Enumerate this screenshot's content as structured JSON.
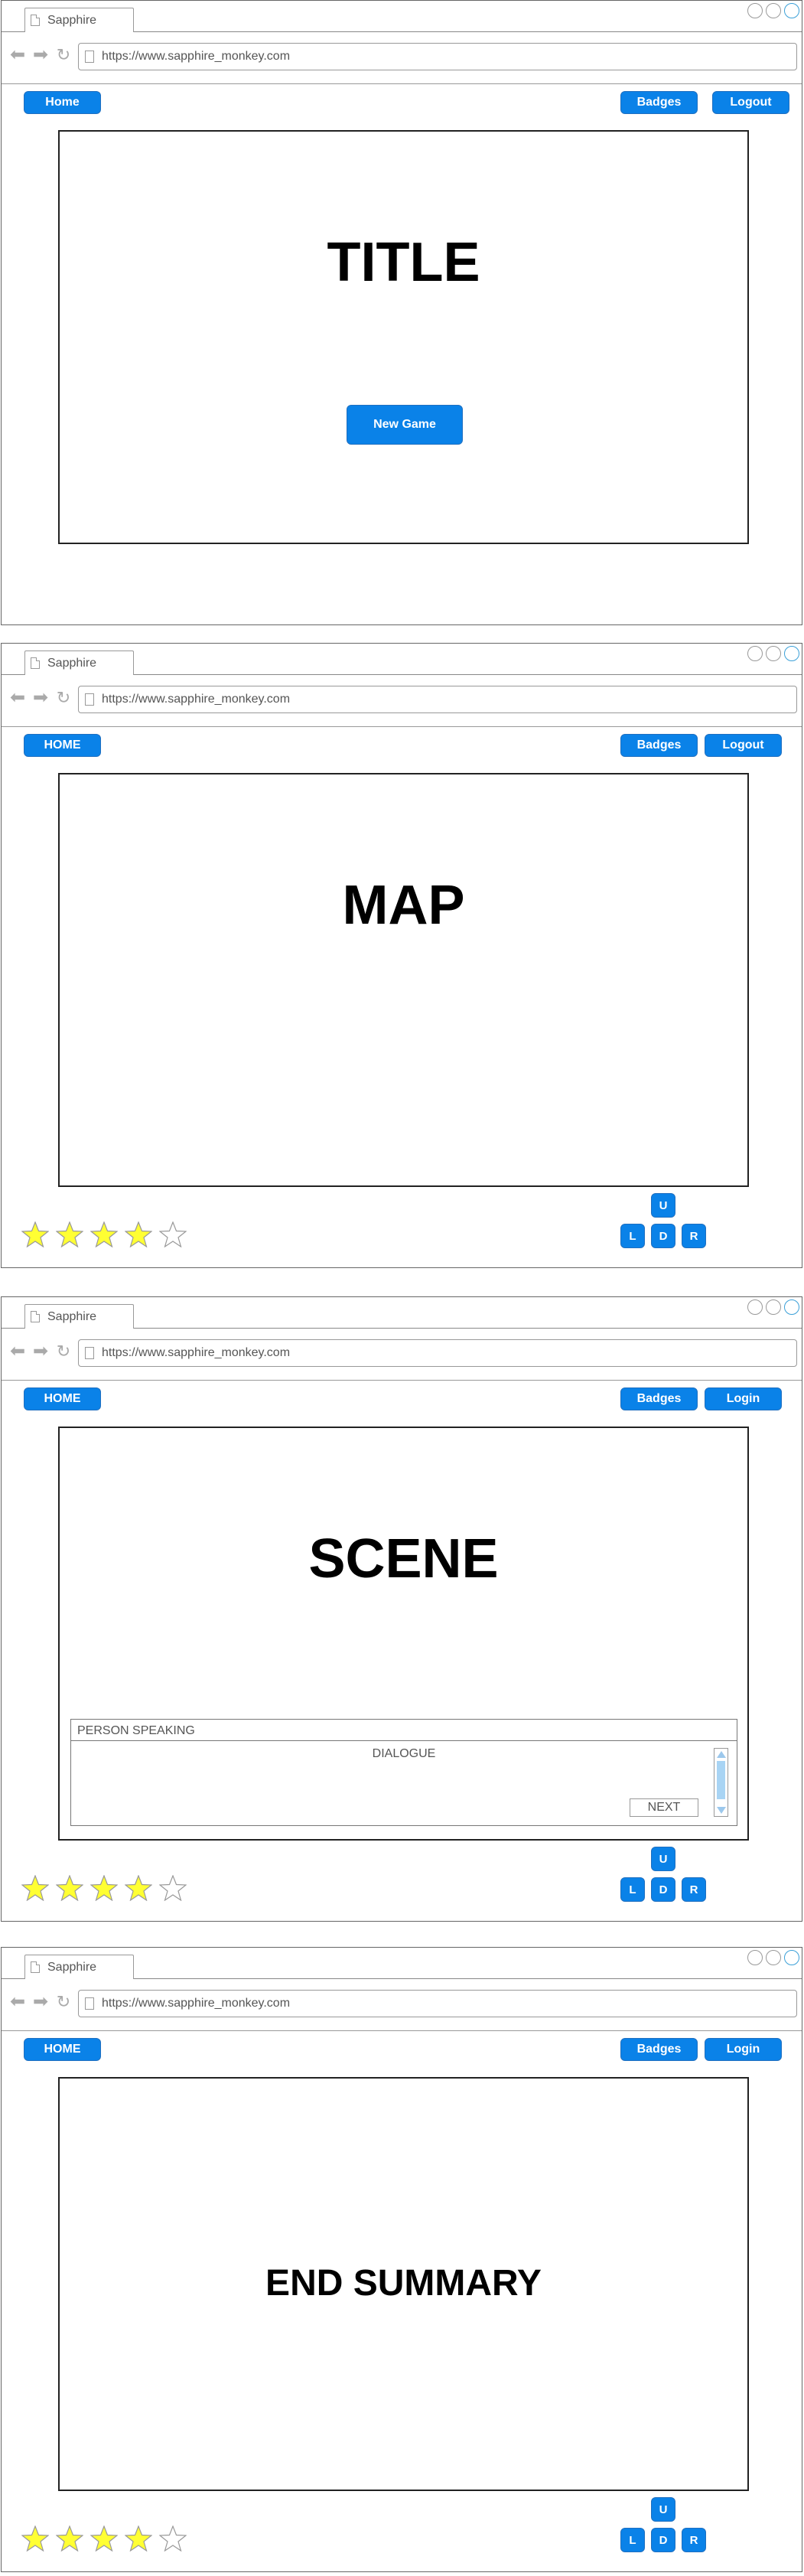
{
  "browser": {
    "tab_label": "Sapphire",
    "url": "https://www.sapphire_monkey.com"
  },
  "frames": [
    {
      "home_label": "Home",
      "badges_label": "Badges",
      "auth_label": "Logout",
      "title": "TITLE",
      "new_game_label": "New Game"
    },
    {
      "home_label": "HOME",
      "badges_label": "Badges",
      "auth_label": "Logout",
      "title": "MAP",
      "stars": {
        "filled": 4,
        "total": 5
      },
      "dpad": {
        "up": "U",
        "left": "L",
        "down": "D",
        "right": "R"
      }
    },
    {
      "home_label": "HOME",
      "badges_label": "Badges",
      "auth_label": "Login",
      "title": "SCENE",
      "dialogue": {
        "speaker": "PERSON SPEAKING",
        "text": "DIALOGUE",
        "next_label": "NEXT"
      },
      "stars": {
        "filled": 4,
        "total": 5
      },
      "dpad": {
        "up": "U",
        "left": "L",
        "down": "D",
        "right": "R"
      }
    },
    {
      "home_label": "HOME",
      "badges_label": "Badges",
      "auth_label": "Login",
      "title": "END SUMMARY",
      "stars": {
        "filled": 4,
        "total": 5
      },
      "dpad": {
        "up": "U",
        "left": "L",
        "down": "D",
        "right": "R"
      }
    }
  ],
  "colors": {
    "button_blue": "#0a82e8",
    "star_fill": "#ffff33"
  },
  "icons": [
    "page-icon",
    "back-arrow-icon",
    "forward-arrow-icon",
    "reload-icon",
    "window-control-icon",
    "star-icon"
  ]
}
